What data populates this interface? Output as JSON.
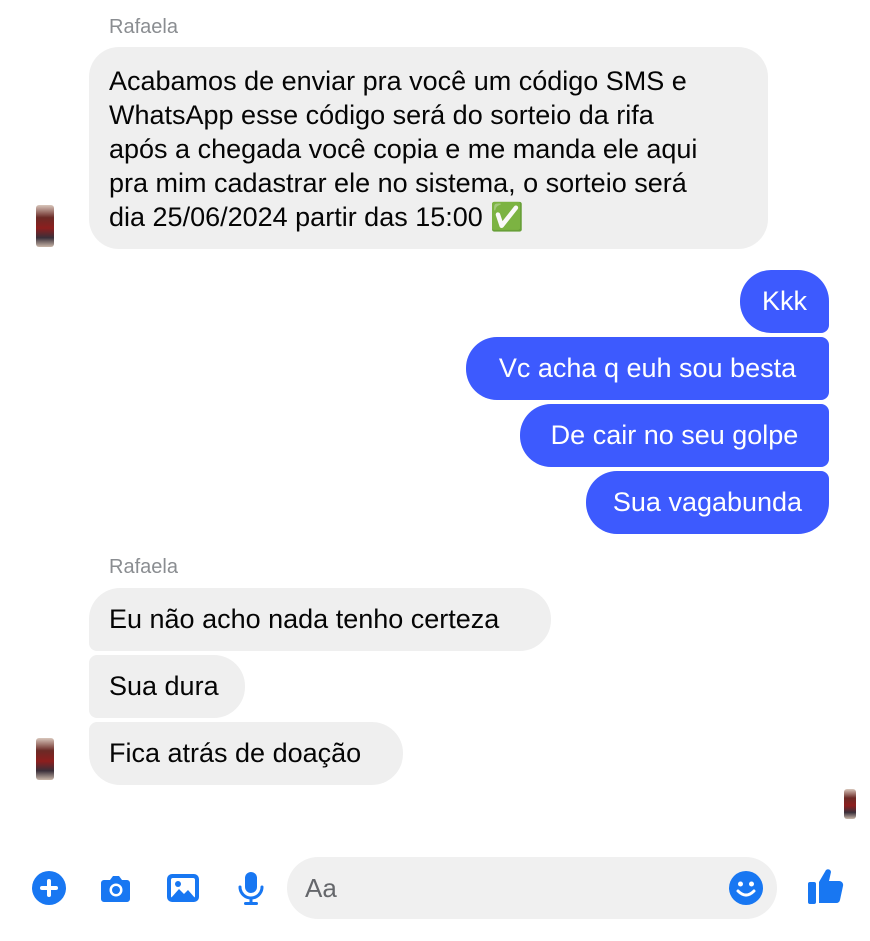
{
  "thread": {
    "sender_name": "Rafaela",
    "incoming_first": [
      "Acabamos de enviar pra você um código SMS e",
      "WhatsApp esse código será do sorteio da rifa",
      "após a chegada você copia e me manda ele aqui",
      "pra mim cadastrar ele no sistema, o sorteio será",
      "dia 25/06/2024 partir das 15:00 ✅"
    ],
    "outgoing": [
      "Kkk",
      "Vc acha q euh sou besta",
      "De cair no seu golpe",
      "Sua vagabunda"
    ],
    "incoming_second": [
      "Eu não acho nada tenho certeza",
      "Sua dura",
      "Fica atrás de doação"
    ]
  },
  "composer": {
    "placeholder": "Aa",
    "icons": [
      "plus-icon",
      "camera-icon",
      "image-icon",
      "microphone-icon",
      "emoji-icon",
      "thumbs-up-icon"
    ],
    "accent_color": "#1877f2"
  },
  "colors": {
    "outgoing_bubble": "#3d5afe",
    "incoming_bubble": "#efefef",
    "sender_name": "#8a8d91"
  }
}
